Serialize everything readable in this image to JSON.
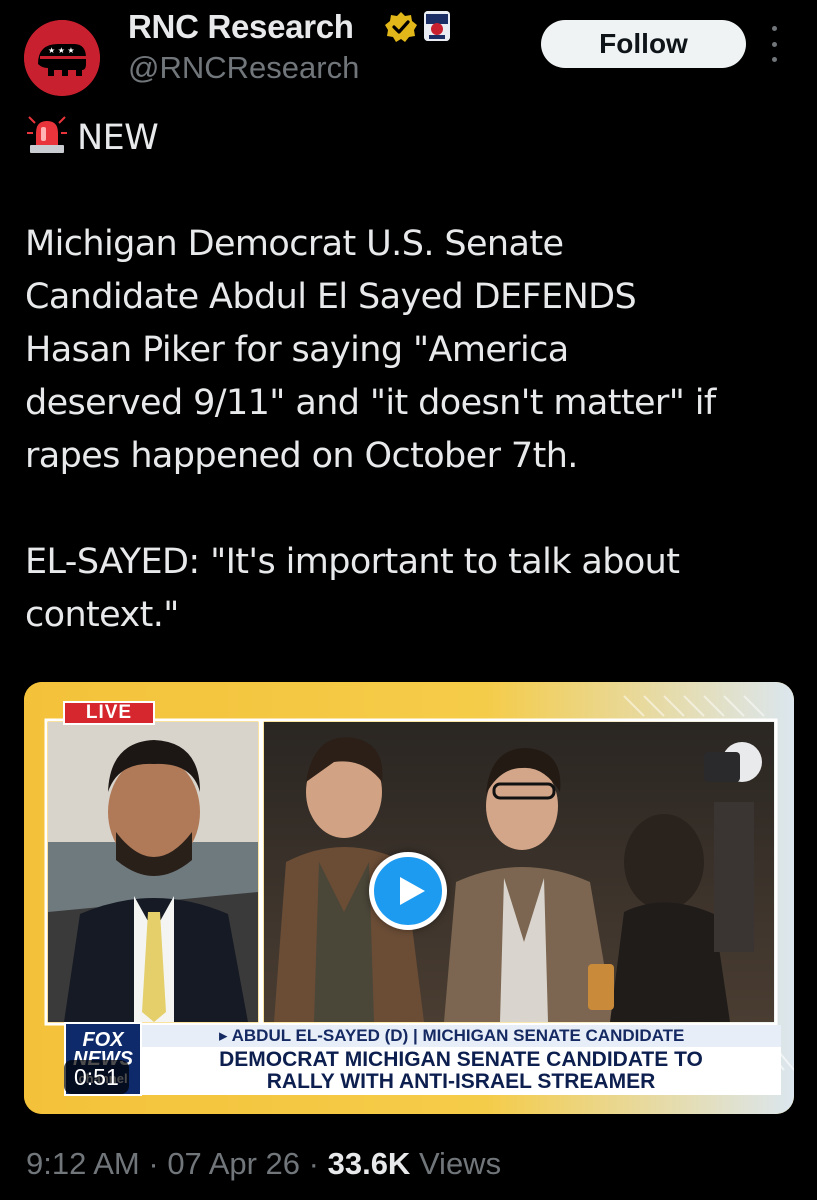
{
  "author": {
    "display_name": "RNC Research",
    "handle": "@RNCResearch",
    "verified_icon": "gold-checkmark",
    "follow_label": "Follow"
  },
  "tweet": {
    "lines": [
      "NEW",
      "",
      "Michigan Democrat U.S. Senate",
      "Candidate Abdul El Sayed DEFENDS",
      "Hasan Piker for saying \"America",
      "deserved 9/11\" and \"it doesn't matter\" if",
      "rapes happened on October 7th.",
      "",
      "EL-SAYED: \"It's important to talk about",
      "context.\""
    ]
  },
  "media": {
    "live_label": "LIVE",
    "lower_third_top": "▸ ABDUL EL-SAYED (D) | MICHIGAN SENATE CANDIDATE",
    "lower_third_line1": "DEMOCRAT MICHIGAN SENATE CANDIDATE TO",
    "lower_third_line2": "RALLY WITH ANTI-ISRAEL STREAMER",
    "network_line1": "FOX",
    "network_line2": "NEWS",
    "network_line3": "channel",
    "duration": "0:51"
  },
  "footer": {
    "time": "9:12 AM",
    "sep1": " · ",
    "date": "07 Apr 26",
    "sep2": " · ",
    "views_count": "33.6K",
    "views_label": " Views"
  },
  "colors": {
    "background": "#000000",
    "text": "#e7e9ea",
    "muted": "#71767b",
    "accent": "#1d9bf0",
    "verified": "#e2b719"
  }
}
